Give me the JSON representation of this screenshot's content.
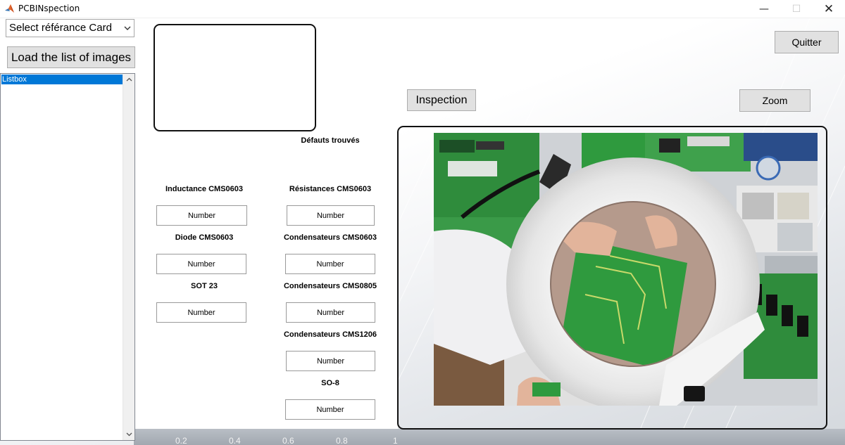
{
  "window": {
    "title": "PCBINspection",
    "minimize": "—",
    "maximize": "☐",
    "close": "✕"
  },
  "left_panel": {
    "select_card": "Select référance Card",
    "load_button": "Load the list of images",
    "listbox": {
      "items": [
        "Listbox"
      ]
    }
  },
  "buttons": {
    "inspection": "Inspection",
    "quitter": "Quitter",
    "zoom": "Zoom"
  },
  "defects": {
    "heading": "Défauts trouvés",
    "left_column": [
      {
        "label": "Inductance CMS0603",
        "value": "Number"
      },
      {
        "label": "Diode CMS0603",
        "value": "Number"
      },
      {
        "label": "SOT 23",
        "value": "Number"
      }
    ],
    "right_column": [
      {
        "label": "Résistances CMS0603",
        "value": "Number"
      },
      {
        "label": "Condensateurs CMS0603",
        "value": "Number"
      },
      {
        "label": "Condensateurs CMS0805",
        "value": "Number"
      },
      {
        "label": "Condensateurs CMS1206",
        "value": "Number"
      },
      {
        "label": "SO-8",
        "value": "Number"
      }
    ]
  },
  "axis_ticks": [
    "0.2",
    "0.4",
    "0.6",
    "0.8",
    "1"
  ],
  "colors": {
    "selection": "#0078d7",
    "button_face": "#e1e1e1",
    "pcb_green": "#2f9a3e"
  },
  "icons": {
    "app": "matlab-icon",
    "dropdown": "chevron-down-icon",
    "scroll_up": "chevron-up-icon",
    "scroll_down": "chevron-down-icon"
  }
}
